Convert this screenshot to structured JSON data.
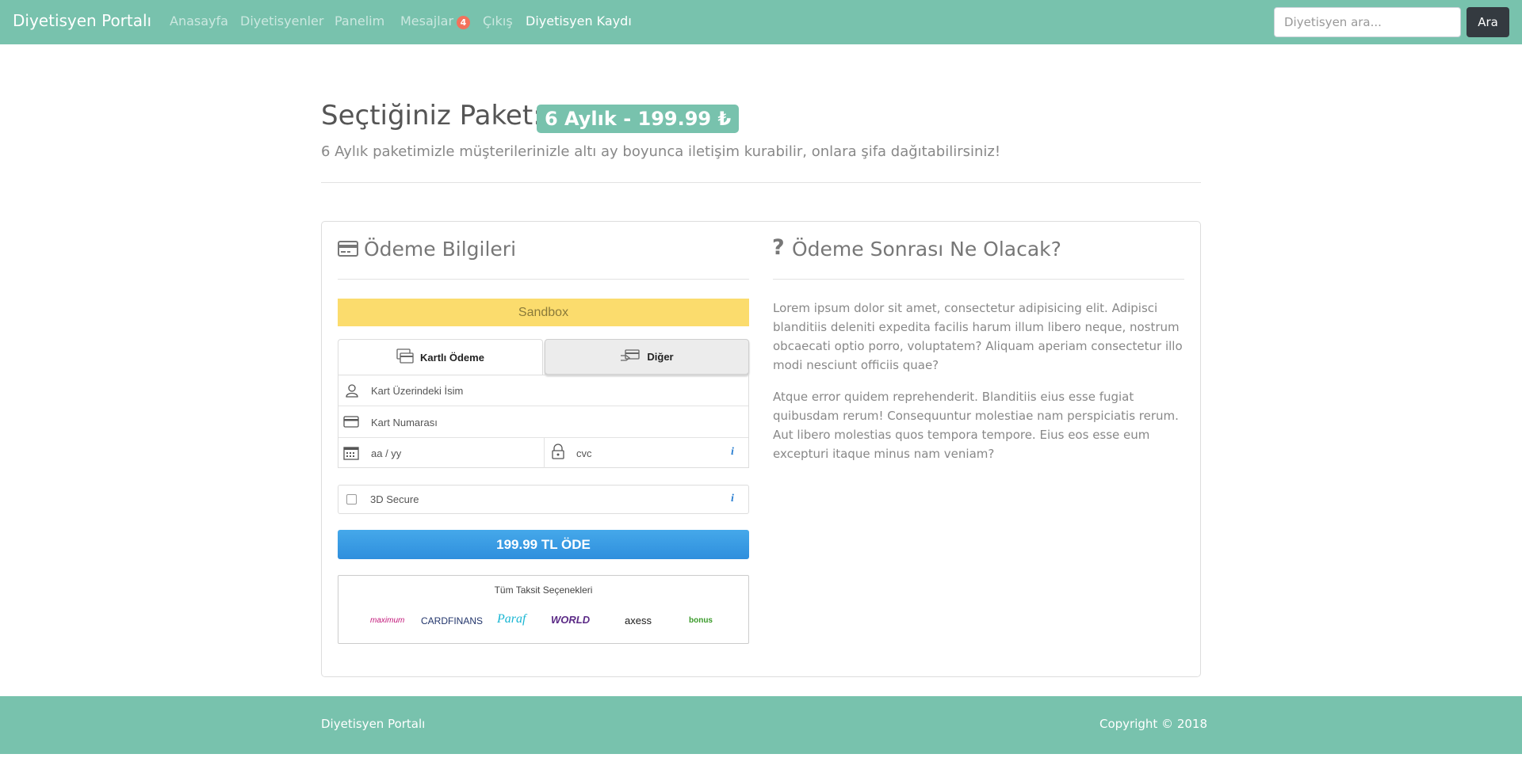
{
  "navbar": {
    "brand": "Diyetisyen Portalı",
    "links": [
      "Anasayfa",
      "Diyetisyenler",
      "Panelim",
      "Mesajlar",
      "Çıkış",
      "Diyetisyen Kaydı"
    ],
    "messages_badge": "4",
    "search_placeholder": "Diyetisyen ara...",
    "search_button": "Ara",
    "color": "#78c2ad"
  },
  "header": {
    "title": "Seçtiğiniz Paket:",
    "package": "6 Aylık - 199.99 ₺",
    "lead": "6 Aylık paketimizle müşterilerinizle altı ay boyunca iletişim kurabilir, onlara şifa dağıtabilirsiniz!"
  },
  "payment": {
    "title": "Ödeme Bilgileri",
    "sandbox": "Sandbox",
    "tabs": [
      "Kartlı Ödeme",
      "Diğer"
    ],
    "fields": {
      "name_placeholder": "Kart Üzerindeki İsim",
      "number_placeholder": "Kart Numarası",
      "expiry_placeholder": "aa / yy",
      "cvc_placeholder": "cvc"
    },
    "info_symbol": "i",
    "secure_label": "3D Secure",
    "pay_button": "199.99 TL ÖDE",
    "installments_title": "Tüm Taksit Seçenekleri",
    "banks": [
      "maximum",
      "CARDFINANS",
      "Paraf",
      "WORLD",
      "axess",
      "bonus"
    ]
  },
  "after": {
    "title": "Ödeme Sonrası Ne Olacak?",
    "paragraphs": [
      "Lorem ipsum dolor sit amet, consectetur adipisicing elit. Adipisci blanditiis deleniti expedita facilis harum illum libero neque, nostrum obcaecati optio porro, voluptatem? Aliquam aperiam consectetur illo modi nesciunt officiis quae?",
      "Atque error quidem reprehenderit. Blanditiis eius esse fugiat quibusdam rerum! Consequuntur molestiae nam perspiciatis rerum. Aut libero molestias quos tempora tempore. Eius eos esse eum excepturi itaque minus nam veniam?"
    ]
  },
  "footer": {
    "left": "Diyetisyen Portalı",
    "right": "Copyright © 2018"
  }
}
